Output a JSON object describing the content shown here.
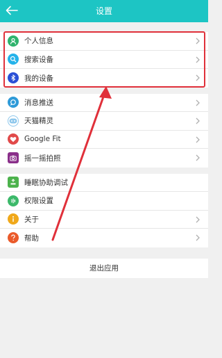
{
  "header": {
    "title": "设置"
  },
  "groups": [
    [
      {
        "label": "个人信息",
        "icon": "person-icon",
        "color": "#2fb36d"
      },
      {
        "label": "搜索设备",
        "icon": "search-icon",
        "color": "#25b3ea"
      },
      {
        "label": "我的设备",
        "icon": "bluetooth-icon",
        "color": "#2a4fd6"
      }
    ],
    [
      {
        "label": "消息推送",
        "icon": "message-icon",
        "color": "#2e9ad8"
      },
      {
        "label": "天猫精灵",
        "icon": "tmall-genie-icon",
        "color": "#8ec7ec"
      },
      {
        "label": "Google Fit",
        "icon": "heart-icon",
        "color": "#e14a4a"
      },
      {
        "label": "摇一摇拍照",
        "icon": "camera-icon",
        "color": "#8a2f8a"
      }
    ],
    [
      {
        "label": "睡眠协助调试",
        "icon": "sleep-icon",
        "color": "#4cb24c"
      },
      {
        "label": "权限设置",
        "icon": "gear-icon",
        "color": "#3cb96a"
      },
      {
        "label": "关于",
        "icon": "info-icon",
        "color": "#f0a81a"
      },
      {
        "label": "帮助",
        "icon": "question-icon",
        "color": "#ea5a2a"
      }
    ]
  ],
  "exit": {
    "label": "退出应用"
  },
  "colors": {
    "accent": "#1dc5c4",
    "annotation": "#e0303a"
  }
}
